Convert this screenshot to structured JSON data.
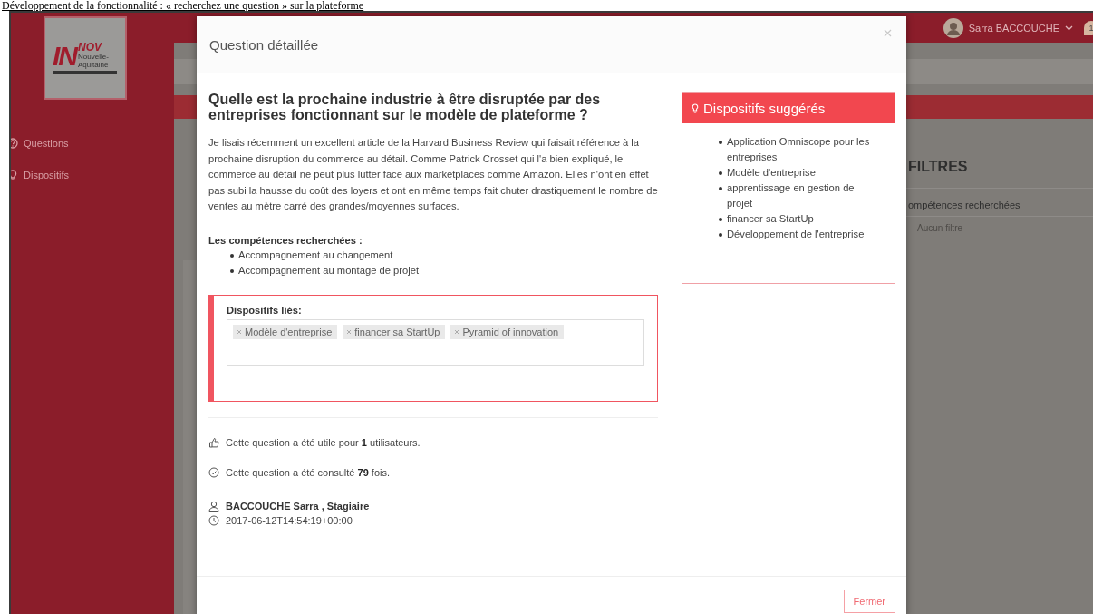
{
  "caption": "Développement de la fonctionnalité : « recherchez une question » sur la plateforme",
  "logo": {
    "main": "IN",
    "super": "NOV",
    "region": "Nouvelle-Aquitaine"
  },
  "sidebar": {
    "items": [
      {
        "kind": "questions",
        "label": "Questions"
      },
      {
        "kind": "dispositifs",
        "label": "Dispositifs"
      }
    ]
  },
  "topbar": {
    "user_name": "Sarra BACCOUCHE",
    "notification_count": "1"
  },
  "filters": {
    "title": "FILTRES",
    "fields": [
      {
        "label": "ompétences recherchées",
        "placeholder": "Aucun filtre"
      }
    ]
  },
  "modal": {
    "title": "Question détaillée",
    "question": "Quelle est la prochaine industrie à être disruptée par des entreprises fonctionnant sur le modèle de plateforme ?",
    "body": "Je lisais récemment un excellent article de la Harvard Business Review qui faisait référence à la prochaine disruption du commerce au détail. Comme Patrick Crosset qui l'a bien expliqué, le commerce au détail ne peut plus lutter face aux marketplaces comme Amazon. Elles n'ont en effet pas subi la hausse du coût des loyers et ont en même temps fait chuter drastiquement le nombre de ventes au mètre carré des grandes/moyennes surfaces.",
    "skills_label": "Les compétences recherchées :",
    "skills": [
      "Accompagnement au changement",
      "Accompagnement au montage de projet"
    ],
    "linked_label": "Dispositifs liés:",
    "linked_tags": [
      "Modèle d'entreprise",
      "financer sa StartUp",
      "Pyramid of innovation"
    ],
    "suggested_title": "Dispositifs suggérés",
    "suggested": [
      "Application Omniscope pour les entreprises",
      "Modèle d'entreprise",
      "apprentissage en gestion de projet",
      "financer sa StartUp",
      "Développement de l'entreprise"
    ],
    "stats": [
      {
        "kind": "likes",
        "text": "Cette question a été utile pour **1** utilisateurs."
      },
      {
        "kind": "views",
        "text": "Cette question a été consulté **79** fois."
      }
    ],
    "author": "BACCOUCHE Sarra , Stagiaire",
    "date": "2017-06-12T14:54:19+00:00",
    "close_button": "Fermer"
  }
}
